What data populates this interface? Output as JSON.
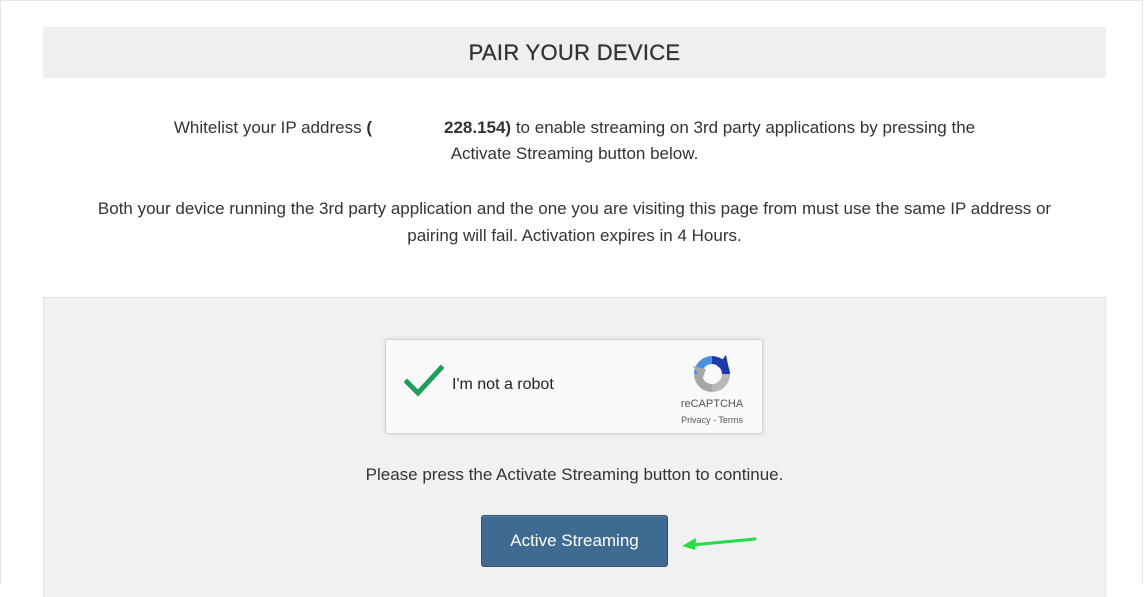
{
  "header": {
    "title": "PAIR YOUR DEVICE"
  },
  "intro": {
    "prefix": "Whitelist your IP address ",
    "ip_open": "(",
    "ip_visible": "228.154)",
    "suffix": " to enable streaming on 3rd party applications by pressing the",
    "line2": "Activate Streaming button below."
  },
  "note": {
    "line1": "Both your device running the 3rd party application and the one you are visiting this page from must use the same IP address or",
    "line2": "pairing will fail. Activation expires in 4 Hours."
  },
  "captcha": {
    "label": "I'm not a robot",
    "brand": "reCAPTCHA",
    "privacy": "Privacy",
    "separator": " - ",
    "terms": "Terms",
    "check_color": "#1e9e5a",
    "check_icon": "checkmark-icon",
    "logo_icon": "recaptcha-logo-icon"
  },
  "instructions": {
    "text": "Please press the Activate Streaming button to continue."
  },
  "action": {
    "button_label": "Active Streaming",
    "button_color": "#3f6b93",
    "annotation_icon": "arrow-left-icon",
    "annotation_color": "#22dd44"
  }
}
